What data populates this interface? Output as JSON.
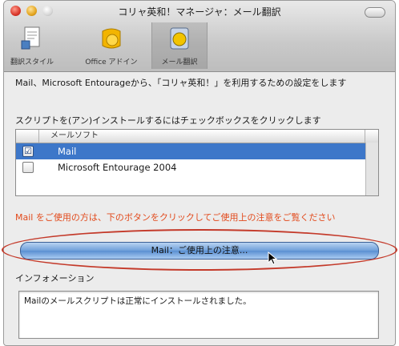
{
  "window": {
    "title": "コリャ英和！マネージャ：メール翻訳"
  },
  "toolbar": {
    "items": [
      {
        "label": "翻訳スタイル",
        "icon": "translation-style-icon"
      },
      {
        "label": "Office アドイン",
        "icon": "office-addin-icon"
      },
      {
        "label": "メール翻訳",
        "icon": "mail-translation-icon",
        "selected": true
      }
    ]
  },
  "main": {
    "description": "Mail、Microsoft Entourageから、「コリャ英和！」を利用するための設定をします",
    "instruction": "スクリプトを(アン)インストールするにはチェックボックスをクリックします",
    "table": {
      "column": "メールソフト",
      "rows": [
        {
          "checked": true,
          "check_glyph": "☑",
          "name": "Mail",
          "selected": true
        },
        {
          "checked": false,
          "check_glyph": "",
          "name": "Microsoft Entourage 2004",
          "selected": false
        }
      ]
    },
    "warning": "Mail をご使用の方は、下のボタンをクリックしてご使用上の注意をご覧ください",
    "mail_button": "Mail：ご使用上の注意...",
    "info_label": "インフォメーション",
    "info_text": "Mailのメールスクリプトは正常にインストールされました。"
  },
  "colors": {
    "accent": "#3d77c9",
    "warning": "#e24a1c",
    "annotation": "#c43a2a"
  }
}
